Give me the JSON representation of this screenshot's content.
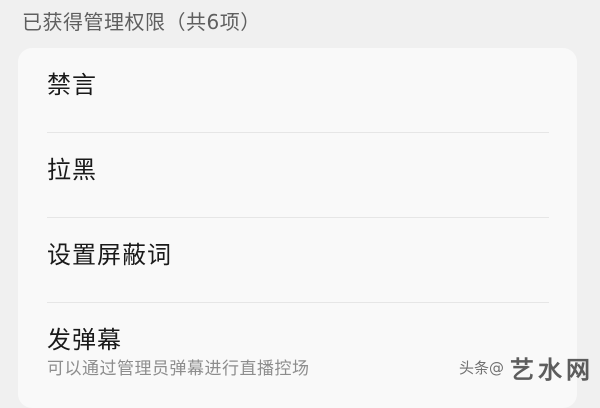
{
  "permissions": {
    "header": "已获得管理权限（共6项）",
    "items": [
      {
        "label": "禁言"
      },
      {
        "label": "拉黑"
      },
      {
        "label": "设置屏蔽词"
      },
      {
        "label": "发弹幕",
        "description": "可以通过管理员弹幕进行直播控场"
      }
    ]
  },
  "watermark": {
    "small_text": "头条@",
    "big_text": "艺水网"
  }
}
